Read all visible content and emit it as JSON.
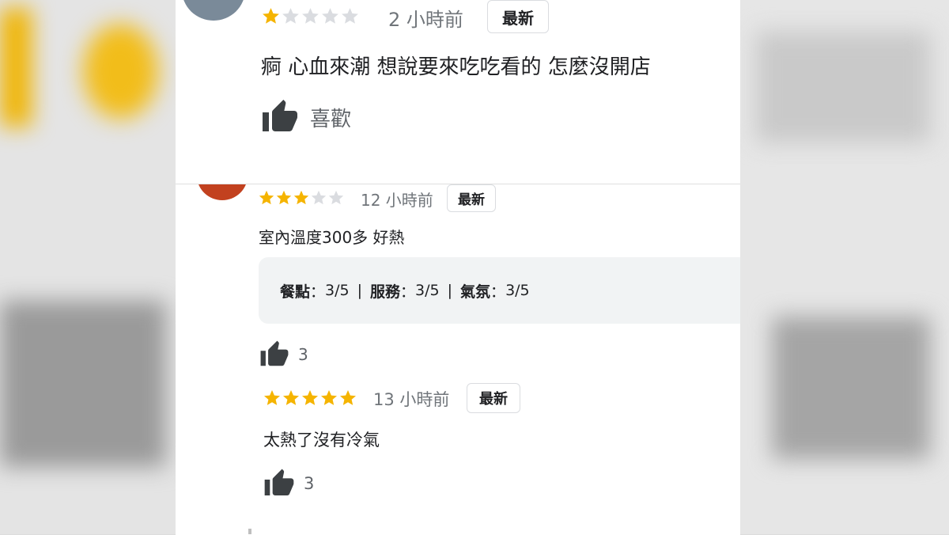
{
  "reviews": [
    {
      "rating": 1,
      "max_rating": 5,
      "time": "2 小時前",
      "badge": "最新",
      "text": "痾 心血來潮 想說要來吃吃看的 怎麼沒開店",
      "like_label": "喜歡",
      "avatar_color": "#7a8a99"
    },
    {
      "rating": 3,
      "max_rating": 5,
      "time": "12 小時前",
      "badge": "最新",
      "text": "室內溫度300多 好熱",
      "ratings_summary": {
        "food_label": "餐點",
        "food_value": "3/5",
        "service_label": "服務",
        "service_value": "3/5",
        "atmosphere_label": "氣氛",
        "atmosphere_value": "3/5"
      },
      "like_count": "3",
      "avatar_color": "#c2411f"
    },
    {
      "rating": 5,
      "max_rating": 5,
      "time": "13 小時前",
      "badge": "最新",
      "text": "太熱了沒有冷氣",
      "like_count": "3"
    }
  ],
  "colors": {
    "star_filled": "#f5b400",
    "star_empty": "#dadce0",
    "thumb": "#3c4043"
  },
  "icons": {
    "star": "star-icon",
    "thumb": "thumbs-up-icon"
  }
}
